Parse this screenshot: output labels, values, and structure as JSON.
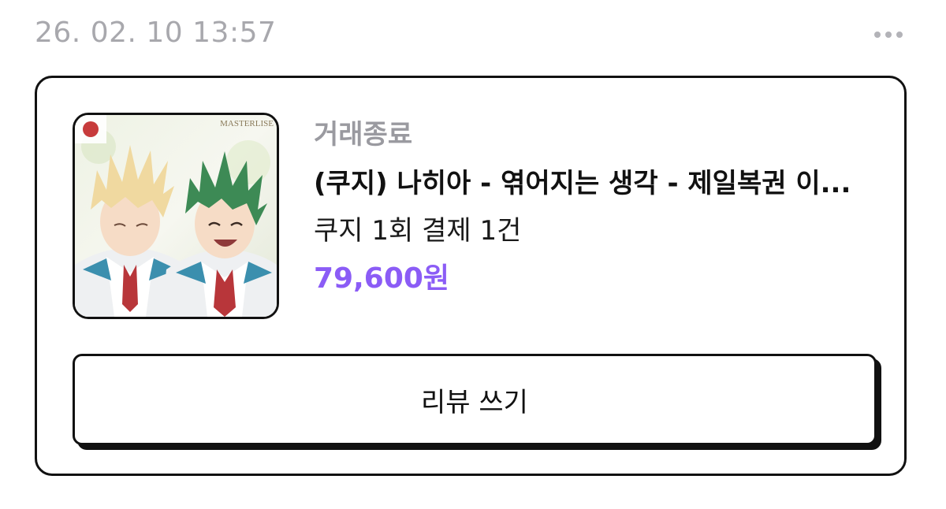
{
  "header": {
    "datetime": "26. 02. 10 13:57",
    "more_icon": "more-horizontal-icon"
  },
  "order": {
    "status": "거래종료",
    "title": "(쿠지) 나히아 - 엮어지는 생각 - 제일복권 이...",
    "subtitle": "쿠지 1회 결제 1건",
    "price": "79,600원",
    "price_color": "#8b5cf6",
    "image": {
      "description": "product-thumbnail",
      "logo_text": "MASTERLISE"
    }
  },
  "actions": {
    "review_label": "리뷰 쓰기"
  }
}
